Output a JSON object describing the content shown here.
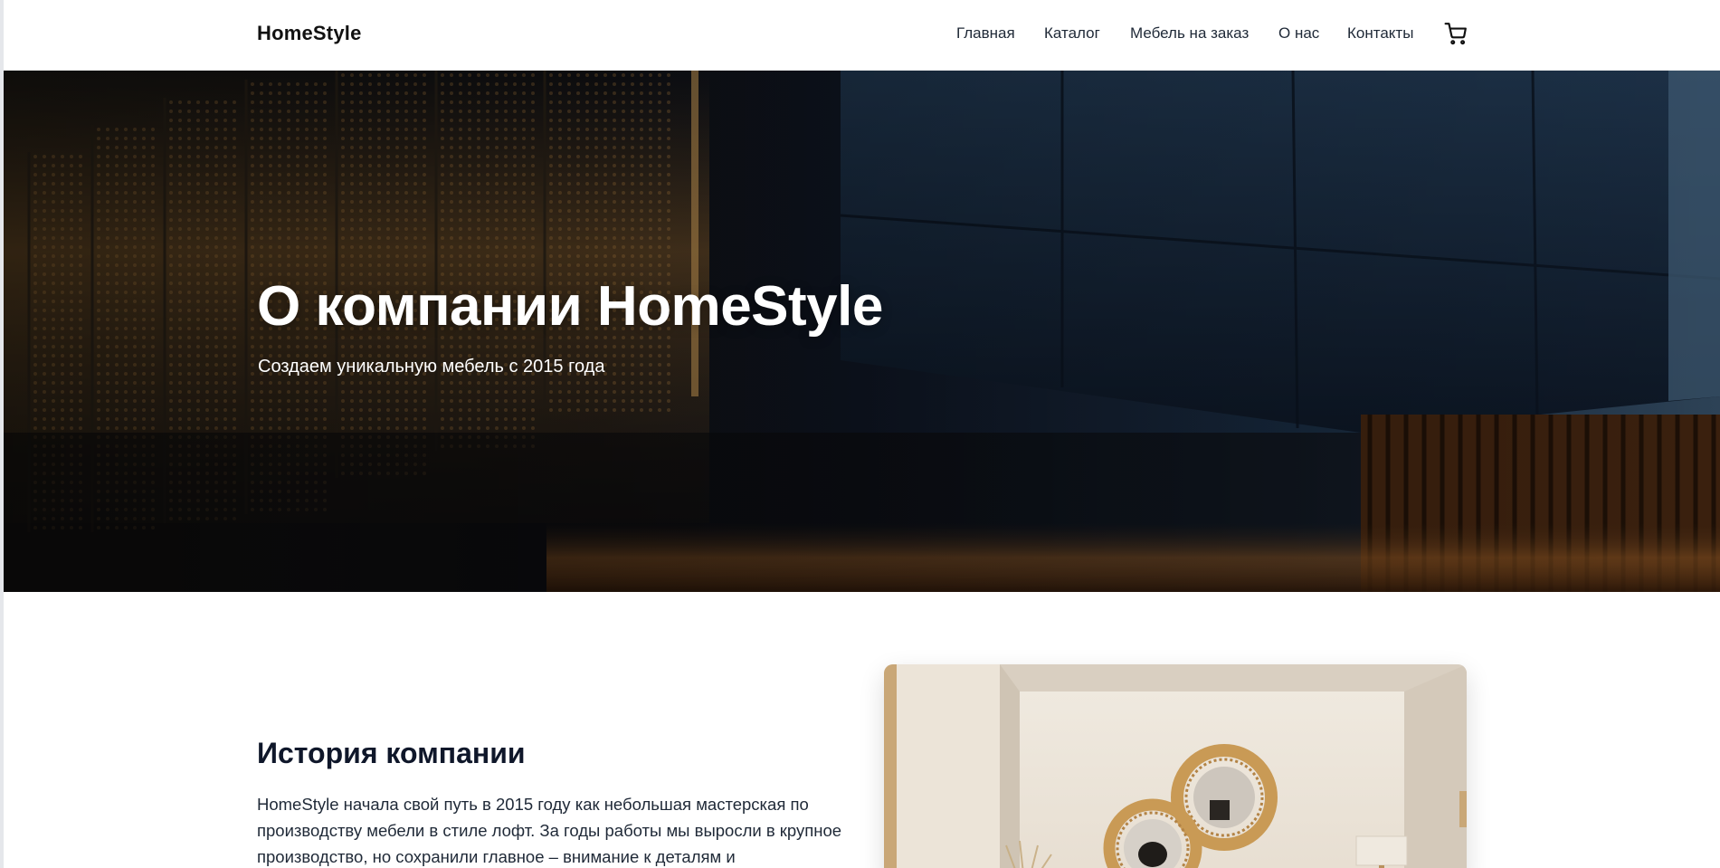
{
  "header": {
    "logo": "HomeStyle",
    "nav": [
      {
        "label": "Главная"
      },
      {
        "label": "Каталог"
      },
      {
        "label": "Мебель на заказ"
      },
      {
        "label": "О нас"
      },
      {
        "label": "Контакты"
      }
    ],
    "cart_icon": "shopping-cart-icon"
  },
  "hero": {
    "title": "О компании HomeStyle",
    "subtitle": "Создаем уникальную мебель с 2015 года"
  },
  "history": {
    "title": "История компании",
    "paragraph": "HomeStyle начала свой путь в 2015 году как небольшая мастерская по производству мебели в стиле лофт. За годы работы мы выросли в крупное производство, но сохранили главное – внимание к деталям и"
  },
  "colors": {
    "text_dark": "#0f172a",
    "hero_text": "#ffffff",
    "background": "#ffffff"
  }
}
